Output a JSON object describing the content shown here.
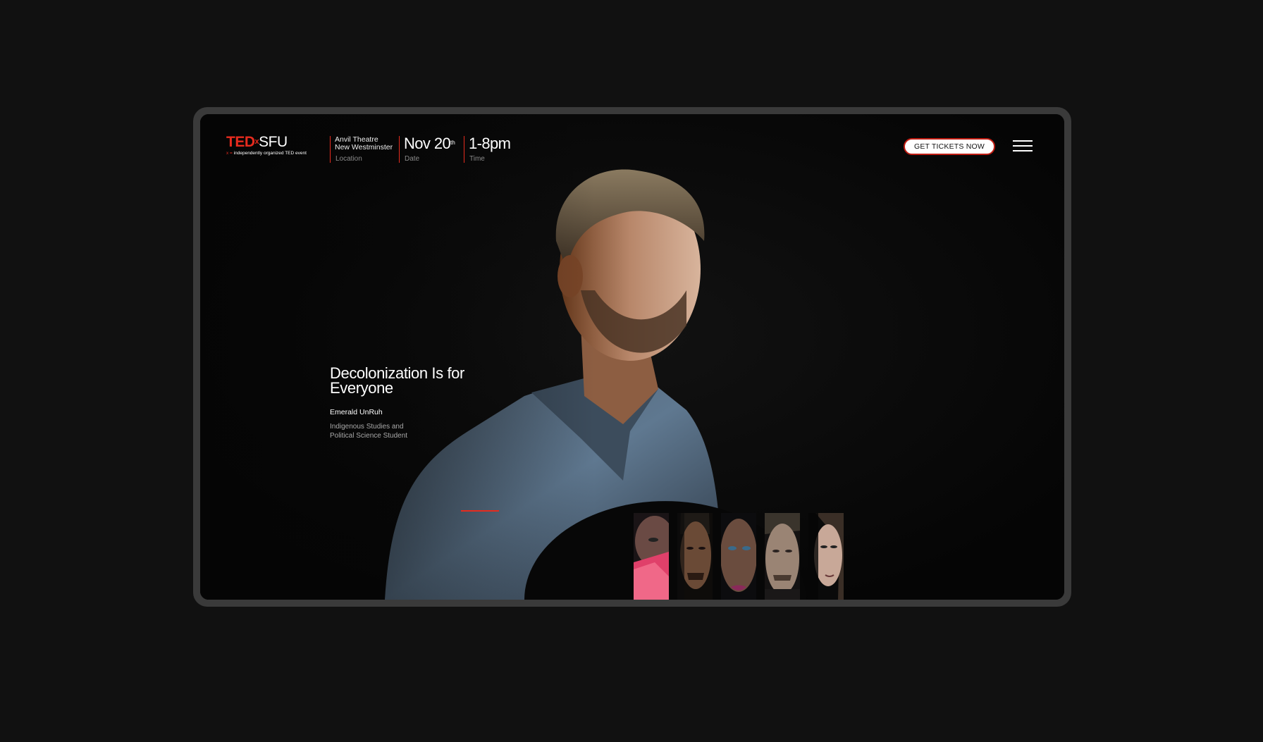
{
  "header": {
    "logo": {
      "ted": "TED",
      "x": "x",
      "sfu": "SFU",
      "tagline_x": "x =",
      "tagline": "independently organized TED event"
    },
    "location": {
      "line1": "Anvil Theatre",
      "line2": "New Westminster",
      "label": "Location"
    },
    "date": {
      "value": "Nov 20",
      "suffix": "th",
      "label": "Date"
    },
    "time": {
      "value": "1-8pm",
      "label": "Time"
    },
    "tickets_label": "GET TICKETS NOW"
  },
  "talk": {
    "title": "Decolonization Is for Everyone",
    "speaker": "Emerald UnRuh",
    "role": "Indigenous Studies and Political Science Student"
  },
  "colors": {
    "accent": "#e62b1e",
    "background": "#050505",
    "frame": "#3a3a3a"
  },
  "icons": {
    "menu": "hamburger-menu-icon"
  },
  "thumbnails": [
    {
      "name": "speaker-thumbnail-1"
    },
    {
      "name": "speaker-thumbnail-2"
    },
    {
      "name": "speaker-thumbnail-3"
    },
    {
      "name": "speaker-thumbnail-4"
    },
    {
      "name": "speaker-thumbnail-5"
    }
  ]
}
